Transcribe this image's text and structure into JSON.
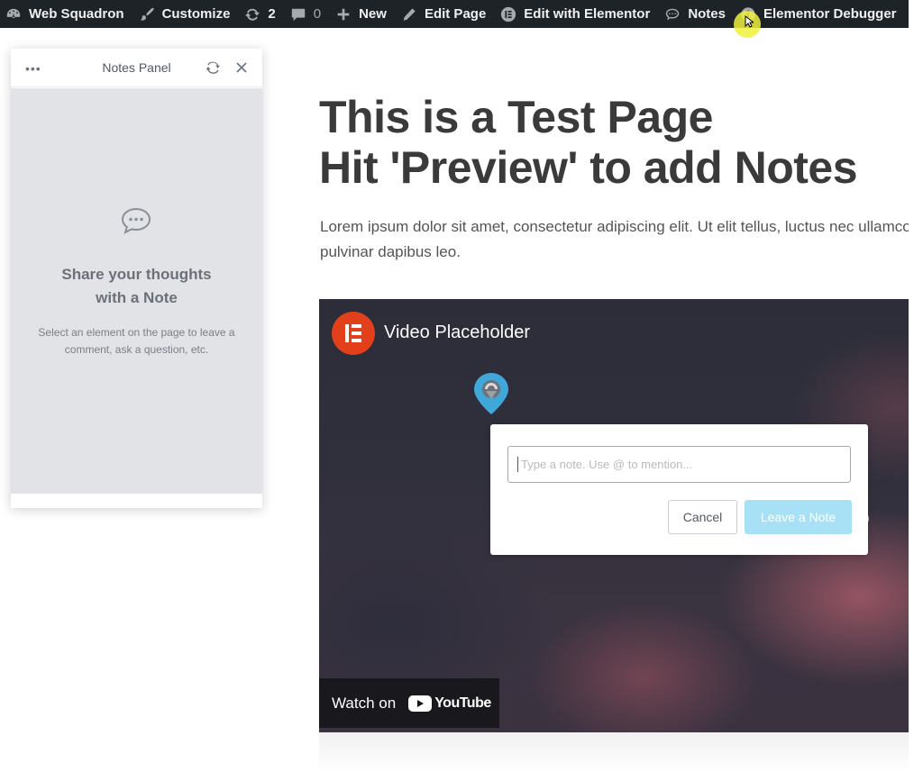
{
  "admin_bar": {
    "site_name": "Web Squadron",
    "customize": "Customize",
    "updates_count": "2",
    "comments_count": "0",
    "new": "New",
    "edit_page": "Edit Page",
    "edit_with_elementor": "Edit with Elementor",
    "notes": "Notes",
    "elementor_debugger": "Elementor Debugger"
  },
  "notes_panel": {
    "title": "Notes Panel",
    "empty_title_line1": "Share your thoughts",
    "empty_title_line2": "with a Note",
    "empty_desc_line1": "Select an element on the page to leave a",
    "empty_desc_line2": "comment, ask a question, etc."
  },
  "page": {
    "heading_line1": "This is a Test Page",
    "heading_line2": "Hit 'Preview' to add Notes",
    "lorem_line1": "Lorem ipsum dolor sit amet, consectetur adipiscing elit. Ut elit tellus, luctus nec ullamcorper mattis,",
    "lorem_line2": "pulvinar dapibus leo."
  },
  "video": {
    "title": "Video Placeholder",
    "watch_on": "Watch on",
    "youtube": "YouTube"
  },
  "note_form": {
    "placeholder": "Type a note. Use @ to mention...",
    "cancel": "Cancel",
    "leave_note": "Leave a Note"
  },
  "colors": {
    "admin_bar_bg": "#1d2327",
    "elementor_red": "#e2401b",
    "pin_blue": "#3fa8d8",
    "leave_button": "#a8e0f5"
  }
}
